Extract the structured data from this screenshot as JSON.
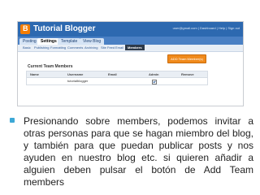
{
  "app": {
    "title": "Tutorial Blogger",
    "user_info": "user@gmail.com | Dashboard | Help | Sign out"
  },
  "tabs": [
    "Posting",
    "Settings",
    "Template",
    "View Blog"
  ],
  "subtabs": [
    "Basic",
    "Publishing",
    "Formatting",
    "Comments",
    "Archiving",
    "Site Feed",
    "Email",
    "Members"
  ],
  "add_button": "ADD Team Member(s)",
  "section": {
    "title": "Current Team Members"
  },
  "table": {
    "headers": [
      "Name",
      "Username",
      "Email",
      "Admin",
      "Remove"
    ],
    "rows": [
      {
        "name": "",
        "username": "tutorialblogger",
        "email": "",
        "admin": true,
        "remove": ""
      }
    ]
  },
  "caption": "Presionando sobre members, podemos invitar a otras personas para que se hagan miembro del blog, y también para que puedan publicar posts y nos ayuden en nuestro blog etc. si quieren añadir a alguien deben pulsar el botón de Add Team members",
  "colors": {
    "header": "#2d69b0",
    "button": "#f08a1c",
    "bullet": "#3da8d6"
  }
}
